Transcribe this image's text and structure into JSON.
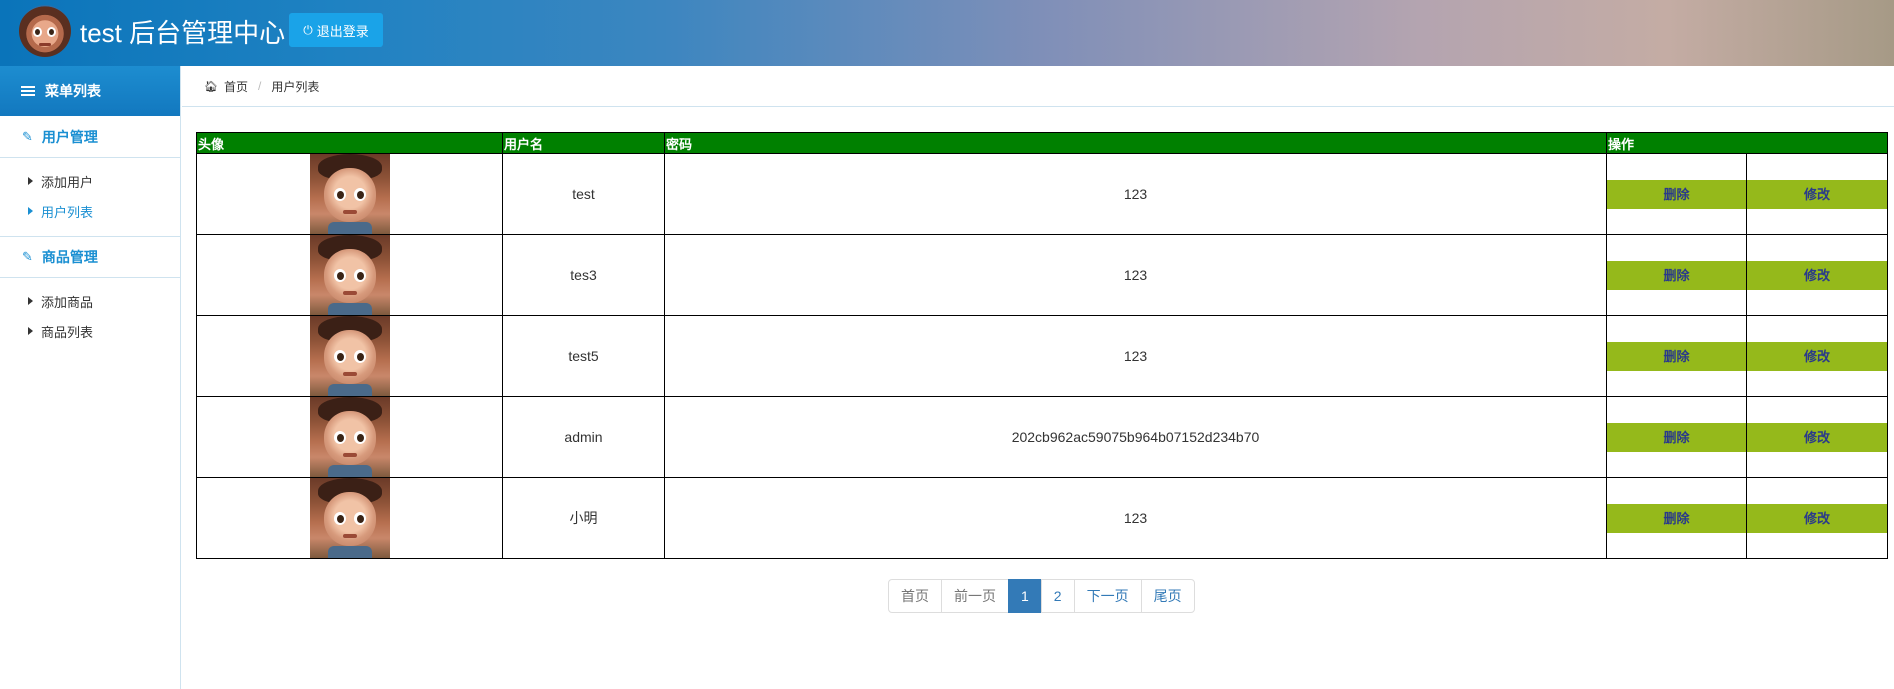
{
  "header": {
    "title": "test 后台管理中心",
    "logout_label": "退出登录"
  },
  "sidebar": {
    "menu_title": "菜单列表",
    "groups": [
      {
        "label": "用户管理",
        "items": [
          {
            "label": "添加用户"
          },
          {
            "label": "用户列表"
          }
        ]
      },
      {
        "label": "商品管理",
        "items": [
          {
            "label": "添加商品"
          },
          {
            "label": "商品列表"
          }
        ]
      }
    ]
  },
  "breadcrumb": {
    "home": "首页",
    "current": "用户列表"
  },
  "table": {
    "headers": [
      "头像",
      "用户名",
      "密码",
      "操作"
    ],
    "delete_label": "删除",
    "edit_label": "修改",
    "rows": [
      {
        "username": "test",
        "password": "123"
      },
      {
        "username": "tes3",
        "password": "123"
      },
      {
        "username": "test5",
        "password": "123"
      },
      {
        "username": "admin",
        "password": "202cb962ac59075b964b07152d234b70"
      },
      {
        "username": "小明",
        "password": "123"
      }
    ]
  },
  "pagination": {
    "first": "首页",
    "prev": "前一页",
    "pages": [
      "1",
      "2"
    ],
    "current": "1",
    "next": "下一页",
    "last": "尾页"
  },
  "colors": {
    "header_start": "#0a74ba",
    "accent": "#1a8fd2",
    "table_header": "#008000",
    "action_button": "#95b91b",
    "page_active": "#337ab7"
  }
}
